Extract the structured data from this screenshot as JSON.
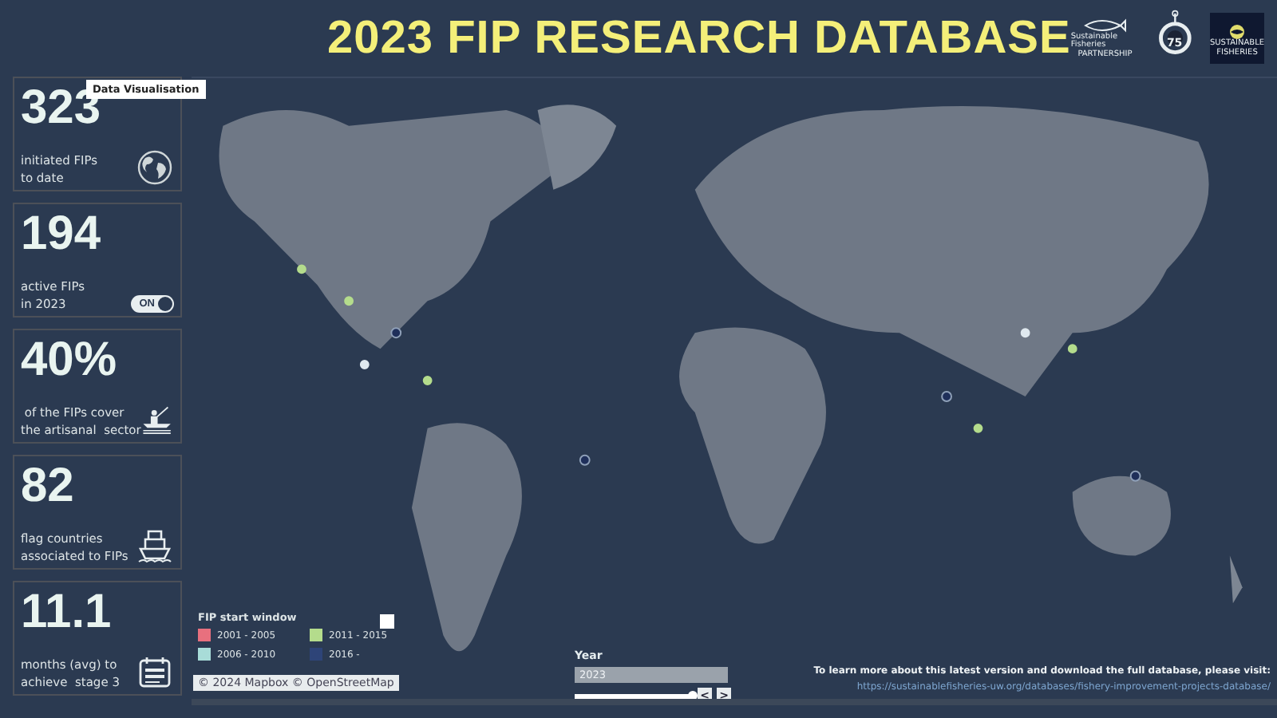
{
  "title": "2023 FIP RESEARCH DATABASE",
  "logos": [
    {
      "kind": "fish",
      "lines": [
        "Sustainable Fisheries",
        "PARTNERSHIP"
      ]
    },
    {
      "kind": "hook",
      "lines": [
        "75"
      ]
    },
    {
      "kind": "badge",
      "lines": [
        "SUSTAINABLE",
        "FISHERIES"
      ]
    }
  ],
  "tooltip": "Data Visualisation",
  "stats": [
    {
      "value": "323",
      "label": [
        "initiated FIPs",
        "to date"
      ]
    },
    {
      "value": "194",
      "label": [
        "active FIPs",
        "in 2023"
      ],
      "toggle": {
        "label": "ON",
        "on": true
      }
    },
    {
      "value": "40%",
      "label": [
        " of the FIPs cover",
        "the artisanal  sector"
      ]
    },
    {
      "value": "82",
      "label": [
        "flag countries",
        "associated to FIPs"
      ]
    },
    {
      "value": "11.1",
      "label": [
        "months (avg) to",
        "achieve  stage 3"
      ]
    }
  ],
  "legend": {
    "title": "FIP start window",
    "checkbox": {
      "checked": false
    },
    "items": [
      {
        "label": "2001 - 2005",
        "color": "#e8707e"
      },
      {
        "label": "2011 - 2015",
        "color": "#b4dc8c"
      },
      {
        "label": "2006 - 2010",
        "color": "#a8dcd8"
      },
      {
        "label": "2016 -",
        "color": "#2e4478"
      }
    ]
  },
  "year": {
    "label": "Year",
    "value": "2023",
    "level": 1,
    "prev": "<",
    "next": ">"
  },
  "attribution": "© 2024 Mapbox  © OpenStreetMap",
  "info": {
    "text": "To learn more about this latest version and download the full database, please visit:",
    "link": "https://sustainablefisheries-uw.org/databases/fishery-improvement-projects-database/"
  }
}
